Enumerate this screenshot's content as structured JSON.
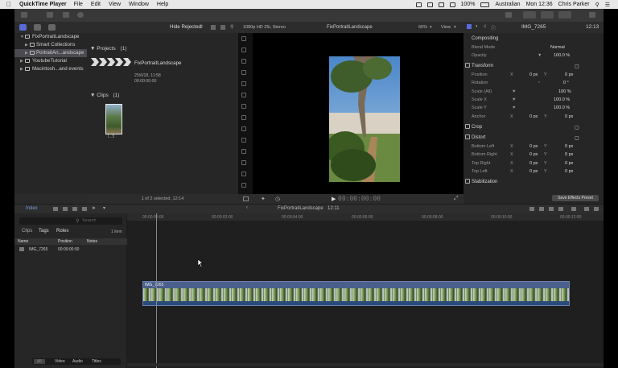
{
  "menubar": {
    "app_name": "QuickTime Player",
    "items": [
      "File",
      "Edit",
      "View",
      "Window",
      "Help"
    ],
    "input_source": "Australian",
    "clock": "Mon 12:36",
    "user": "Chris Parker",
    "battery": "100%"
  },
  "browser": {
    "filter": "Hide Rejected",
    "projects_label": "Projects",
    "projects_count": "(1)",
    "project_name": "FixPortraitLandscape",
    "project_date": "25/6/18, 11:58",
    "project_duration": "00:00:00:00",
    "clips_label": "Clips",
    "clips_count": "(1)",
    "clip_thumb_label": "I...5",
    "status": "1 of 2 selected, 12:14"
  },
  "library": {
    "items": [
      {
        "label": "FixPortraitLandscape",
        "expanded": true
      },
      {
        "label": "Smart Collections",
        "expanded": false
      },
      {
        "label": "PortraitAn...andscape",
        "selected": true
      },
      {
        "label": "YoutubeTutorial",
        "expanded": false
      },
      {
        "label": "Macintosh...and events",
        "expanded": false
      }
    ]
  },
  "viewer": {
    "format": "1080p HD 25i, Stereo",
    "title": "FixPortraitLandscape",
    "zoom": "66%",
    "view_label": "View",
    "timecode": "00:00:00:00"
  },
  "inspector": {
    "clip_name": "IMG_7265",
    "duration": "12:13",
    "compositing": "Compositing",
    "blend_mode_label": "Blend Mode",
    "blend_mode_value": "Normal",
    "opacity_label": "Opacity",
    "opacity_value": "100.0 %",
    "transform": "Transform",
    "position_label": "Position",
    "position_x": "0 px",
    "position_y": "0 px",
    "rotation_label": "Rotation",
    "rotation_value": "0 °",
    "scale_all_label": "Scale (All)",
    "scale_all_value": "100 %",
    "scale_x_label": "Scale X",
    "scale_x_value": "100.0 %",
    "scale_y_label": "Scale Y",
    "scale_y_value": "100.0 %",
    "anchor_label": "Anchor",
    "anchor_x": "0 px",
    "anchor_y": "0 px",
    "crop": "Crop",
    "distort": "Distort",
    "bottom_left_label": "Bottom Left",
    "bottom_right_label": "Bottom Right",
    "top_right_label": "Top Right",
    "top_left_label": "Top Left",
    "zero_px": "0 px",
    "x_label": "X",
    "y_label": "Y",
    "stabilization": "Stabilization",
    "save_preset": "Save Effects Preset"
  },
  "timeline_bar": {
    "index_label": "Index",
    "project_title": "FixPortraitLandscape",
    "duration": "12:11"
  },
  "index_panel": {
    "search_placeholder": "Search",
    "tabs": [
      "Clips",
      "Tags",
      "Roles"
    ],
    "item_count": "1 item",
    "columns": [
      "Name",
      "Position",
      "Notes"
    ],
    "rows": [
      {
        "name": "IMG_7265",
        "position": "00:00:00:00",
        "notes": ""
      }
    ],
    "filters": [
      "All",
      "Video",
      "Audio",
      "Titles"
    ]
  },
  "timeline": {
    "ruler": [
      "00:00:00:00",
      "00:00:02:00",
      "00:00:04:00",
      "00:00:06:00",
      "00:00:08:00",
      "00:00:10:00",
      "00:00:12:00"
    ],
    "clip_name": "IMG_7265"
  }
}
